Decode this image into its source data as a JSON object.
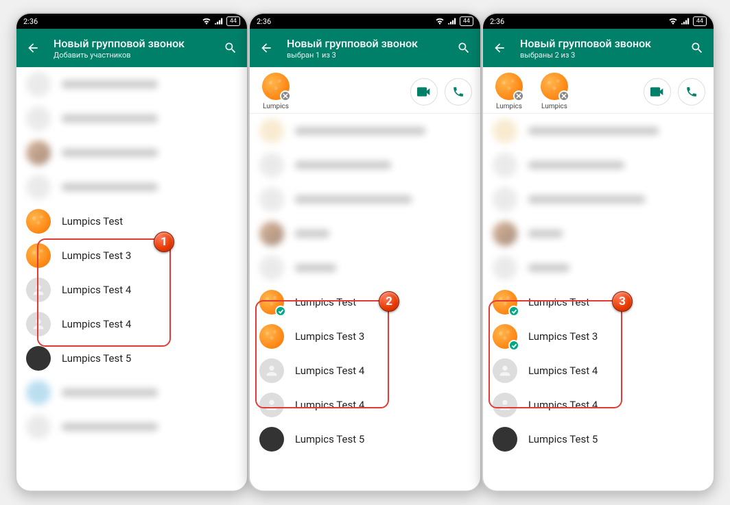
{
  "statusbar": {
    "time": "2:36",
    "battery": "44"
  },
  "appbar": {
    "title": "Новый групповой звонок",
    "sub_add": "Добавить участников",
    "sub_sel1": "выбран 1 из 3",
    "sub_sel2": "выбраны 2 из 3"
  },
  "chip_name": "Lumpics",
  "contacts": {
    "c1": "Lumpics Test",
    "c2": "Lumpics Test 3",
    "c3": "Lumpics Test 4",
    "c4": "Lumpics Test 4",
    "c5": "Lumpics Test 5"
  },
  "steps": {
    "s1": "1",
    "s2": "2",
    "s3": "3"
  }
}
